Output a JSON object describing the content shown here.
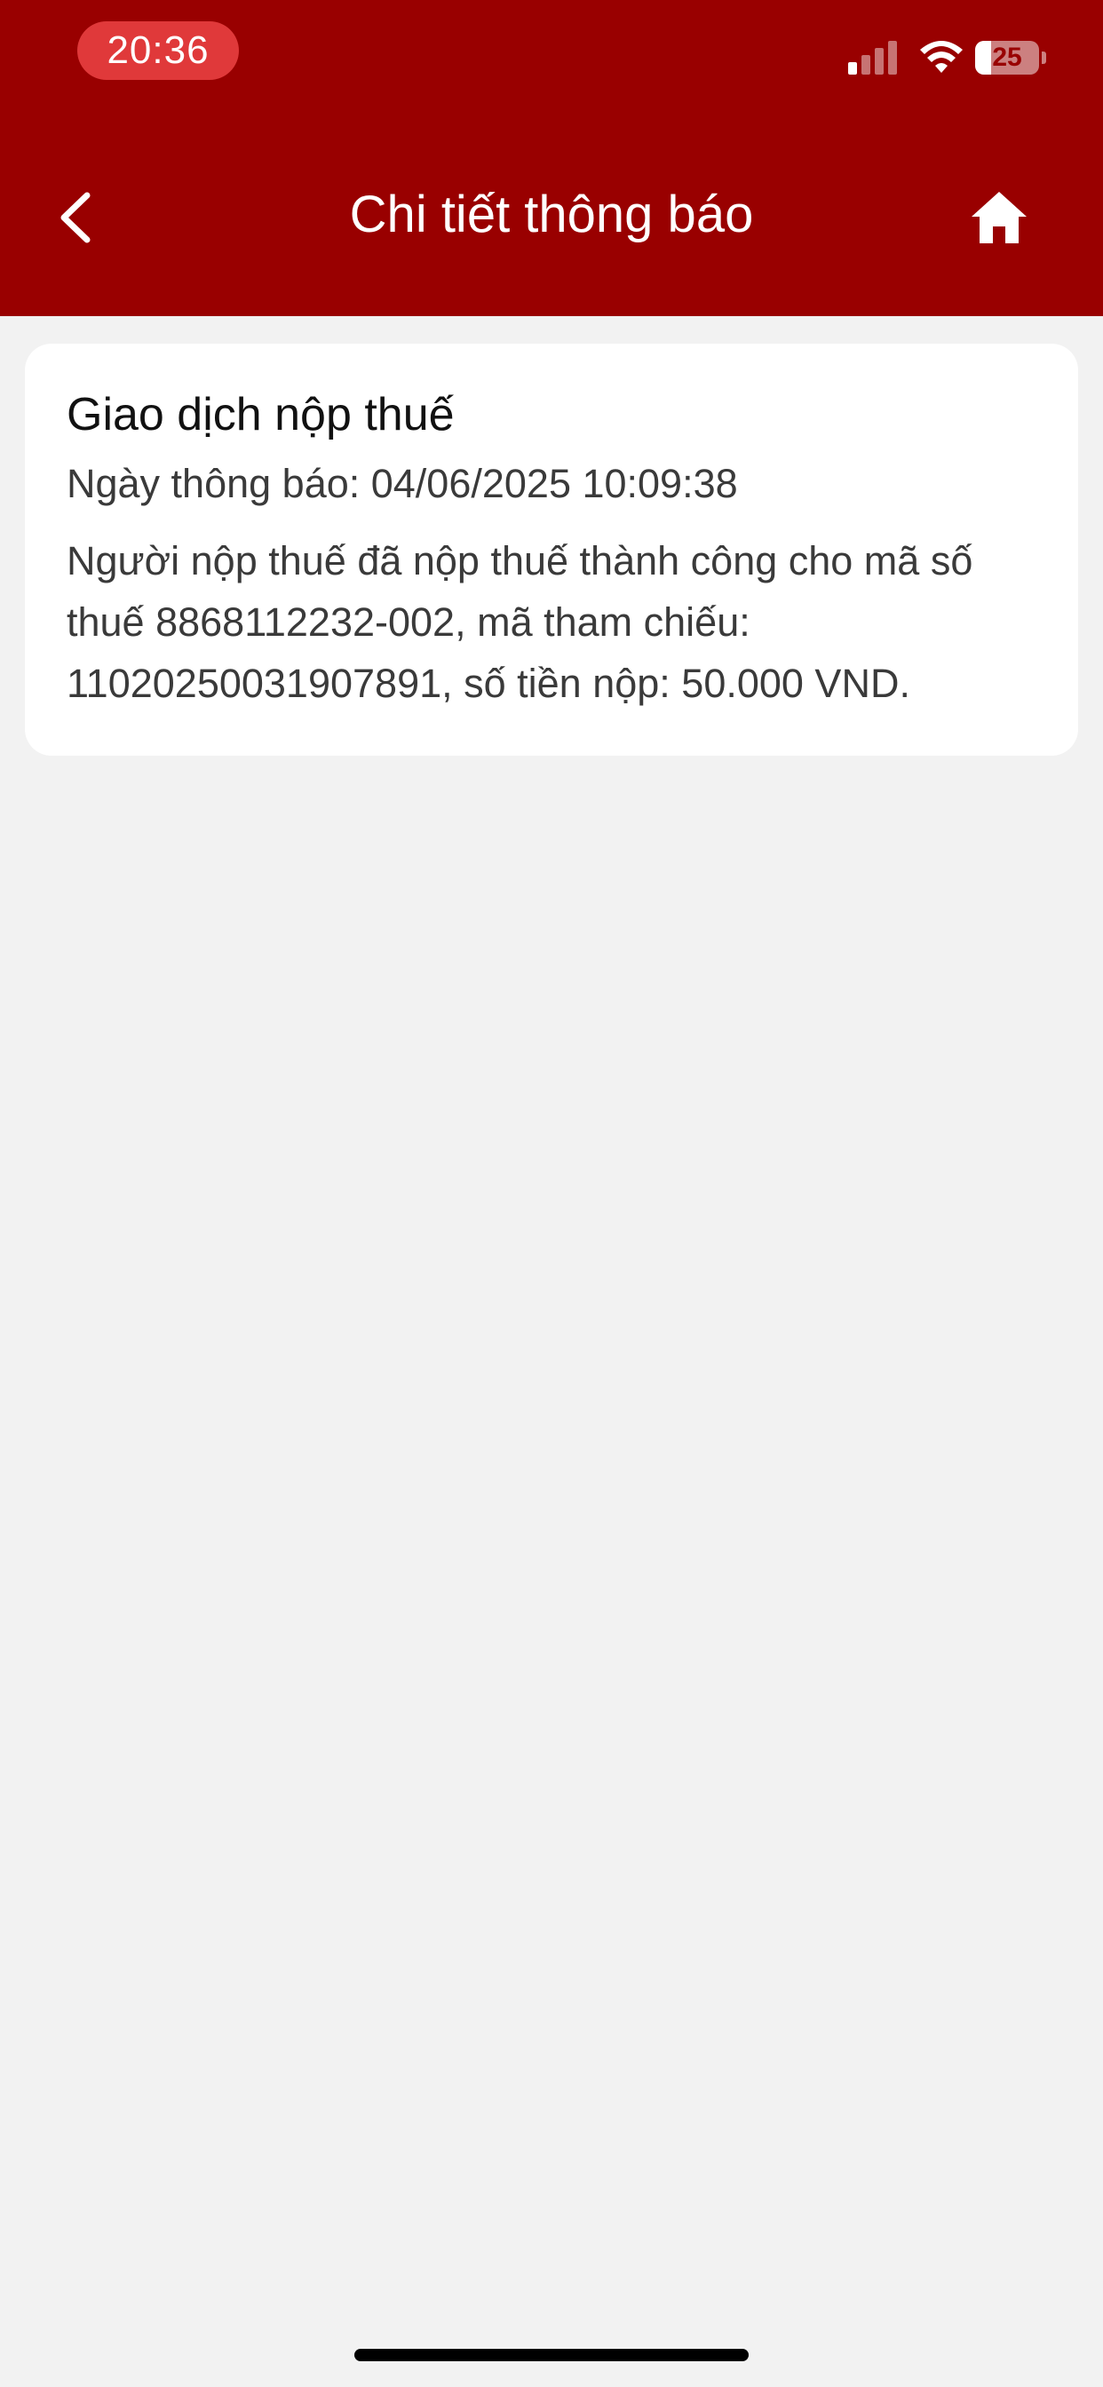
{
  "status_bar": {
    "time": "20:36",
    "battery_percent": "25",
    "battery_level": 0.25,
    "signal_bars_active": 1,
    "signal_bars_total": 4
  },
  "nav": {
    "title": "Chi tiết thông báo",
    "back_icon": "chevron-left-icon",
    "home_icon": "home-icon"
  },
  "notification": {
    "title": "Giao dịch nộp thuế",
    "date_line": "Ngày thông báo: 04/06/2025 10:09:38",
    "body": "Người nộp thuế đã nộp thuế thành công cho mã số thuế 8868112232-002, mã tham chiếu: 11020250031907891, số tiền nộp: 50.000 VND."
  },
  "colors": {
    "header": "#990000",
    "time_pill": "#e0393a",
    "background": "#f2f2f2",
    "card": "#ffffff"
  }
}
